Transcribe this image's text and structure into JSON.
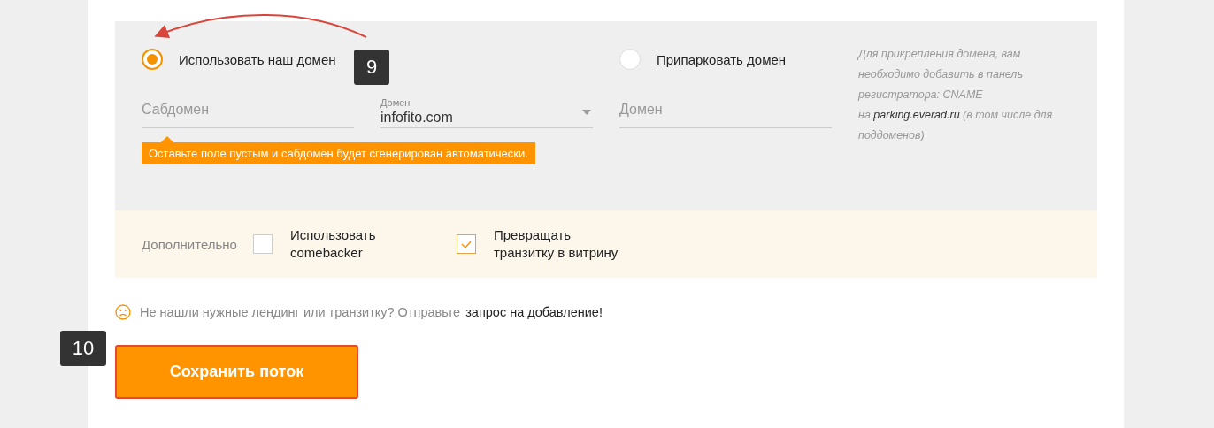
{
  "domain_options": [
    {
      "label": "Использовать наш домен",
      "selected": true
    },
    {
      "label": "Припарковать домен",
      "selected": false
    }
  ],
  "subdomain_field": {
    "placeholder": "Сабдомен"
  },
  "domain_select": {
    "label": "Домен",
    "value": "infofito.com"
  },
  "hint": "Оставьте поле пустым и сабдомен будет сгенерирован автоматически.",
  "park_field": {
    "placeholder": "Домен"
  },
  "note": {
    "text_before": "Для прикрепления домена, вам необходимо добавить в панель регистратора: CNAME",
    "prefix": "на",
    "host": "parking.everad.ru",
    "text_after": "(в том числе для поддоменов)"
  },
  "extras": {
    "label": "Дополнительно",
    "options": [
      {
        "label": "Использовать comebacker",
        "checked": false
      },
      {
        "label": "Превращать транзитку в витрину",
        "checked": true
      }
    ]
  },
  "footer": {
    "text": "Не нашли нужные лендинг или транзитку? Отправьте",
    "link": "запрос на добавление!"
  },
  "save_button": "Сохранить поток",
  "annotations": [
    {
      "label": "9"
    },
    {
      "label": "10"
    }
  ]
}
